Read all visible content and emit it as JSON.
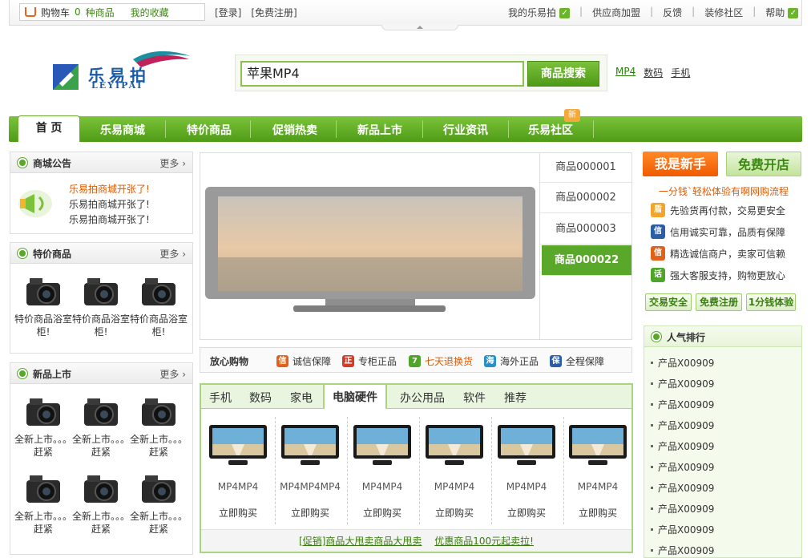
{
  "topbar": {
    "cart_label": "购物车",
    "cart_count": "0",
    "cart_unit": "种商品",
    "favorites": "我的收藏",
    "login": "[登录]",
    "register": "[免费注册]",
    "my_account": "我的乐易拍",
    "supplier": "供应商加盟",
    "feedback": "反馈",
    "community": "装修社区",
    "help": "帮助"
  },
  "logo": {
    "cn": "乐易拍",
    "en": "LEYIPAI"
  },
  "search": {
    "value": "苹果MP4",
    "button": "商品搜索",
    "hot_words": [
      "MP4",
      "数码",
      "手机"
    ]
  },
  "nav": {
    "items": [
      "首 页",
      "乐易商城",
      "特价商品",
      "促销热卖",
      "新品上市",
      "行业资讯",
      "乐易社区"
    ],
    "badge": "新"
  },
  "notice": {
    "title": "商城公告",
    "more": "更多",
    "items": [
      "乐易拍商城开张了!",
      "乐易拍商城开张了!",
      "乐易拍商城开张了!"
    ]
  },
  "special": {
    "title": "特价商品",
    "more": "更多",
    "items": [
      "特价商品浴室柜!",
      "特价商品浴室柜!",
      "特价商品浴室柜!"
    ]
  },
  "newarrival": {
    "title": "新品上市",
    "more": "更多",
    "items": [
      "全新上市。。。赶紧",
      "全新上市。。。赶紧",
      "全新上市。。。赶紧",
      "全新上市。。。赶紧",
      "全新上市。。。赶紧",
      "全新上市。。。赶紧"
    ]
  },
  "banner": {
    "items": [
      "商品000001",
      "商品000002",
      "商品000003",
      "商品000022"
    ],
    "active_index": 3
  },
  "trust": {
    "label": "放心购物",
    "items": [
      {
        "icon": "信",
        "text": "诚信保障",
        "color": "#e0621a"
      },
      {
        "icon": "正",
        "text": "专柜正品",
        "color": "#d43a2a"
      },
      {
        "icon": "7",
        "text": "七天退换货",
        "color": "#4fa52a"
      },
      {
        "icon": "海",
        "text": "海外正品",
        "color": "#2a8fc8"
      },
      {
        "icon": "保",
        "text": "全程保障",
        "color": "#2a5fa8"
      }
    ]
  },
  "product_tabs": {
    "tabs": [
      "手机",
      "数码",
      "家电",
      "电脑硬件",
      "办公用品",
      "软件",
      "推荐"
    ],
    "active_index": 3,
    "products": [
      {
        "name": "MP4MP4",
        "buy": "立即购买"
      },
      {
        "name": "MP4MP4MP4",
        "buy": "立即购买"
      },
      {
        "name": "MP4MP4",
        "buy": "立即购买"
      },
      {
        "name": "MP4MP4",
        "buy": "立即购买"
      },
      {
        "name": "MP4MP4",
        "buy": "立即购买"
      },
      {
        "name": "MP4MP4",
        "buy": "立即购买"
      }
    ],
    "promo_1": "[促销]商品大甩卖商品大甩卖",
    "promo_2": "优惠商品100元起卖拉!"
  },
  "right": {
    "btn_new": "我是新手",
    "btn_shop": "免费开店",
    "info_title": "一分钱`轻松体验有啊网购流程",
    "info_lines": [
      {
        "icon": "盾",
        "text": "先验货再付款，交易更安全",
        "color": "#f2a52a"
      },
      {
        "icon": "信",
        "text": "信用诚实可靠，品质有保障",
        "color": "#2a5fa8"
      },
      {
        "icon": "信",
        "text": "精选诚信商户，卖家可信赖",
        "color": "#e0621a"
      },
      {
        "icon": "话",
        "text": "强大客服支持，购物更放心",
        "color": "#4fa52a"
      }
    ],
    "small_buttons": [
      "交易安全",
      "免费注册",
      "1分钱体验"
    ],
    "rank_title": "人气排行",
    "rank_items": [
      "产品X00909",
      "产品X00909",
      "产品X00909",
      "产品X00909",
      "产品X00909",
      "产品X00909",
      "产品X00909",
      "产品X00909",
      "产品X00909",
      "产品X00909"
    ]
  }
}
